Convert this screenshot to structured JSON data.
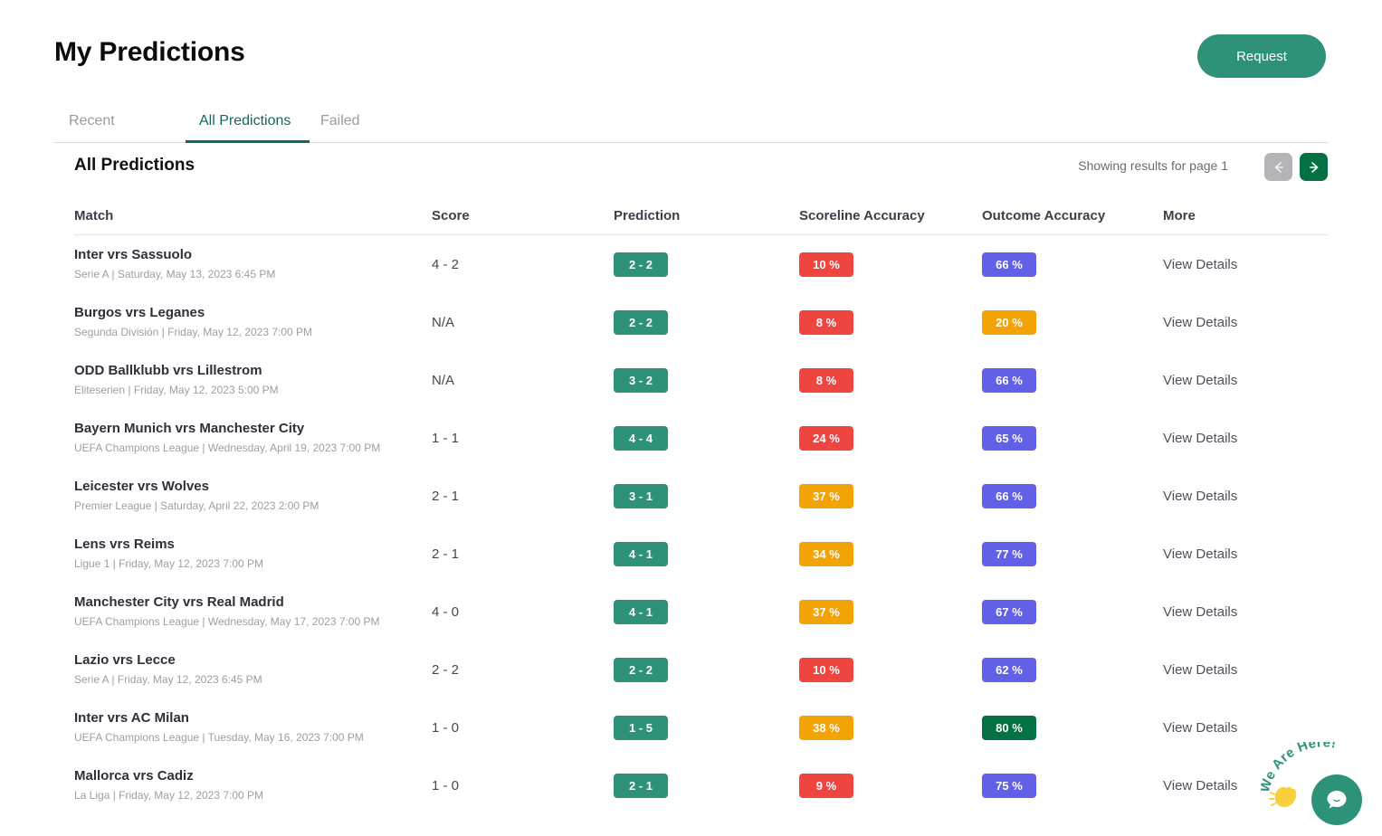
{
  "header": {
    "title": "My Predictions",
    "request_label": "Request"
  },
  "tabs": [
    {
      "label": "Recent",
      "active": false
    },
    {
      "label": "All Predictions",
      "active": true
    },
    {
      "label": "Failed",
      "active": false
    }
  ],
  "section": {
    "title": "All Predictions",
    "results_label": "Showing results for page 1",
    "prev_icon": "arrow-left-icon",
    "next_icon": "arrow-right-icon"
  },
  "table": {
    "columns": [
      "Match",
      "Score",
      "Prediction",
      "Scoreline Accuracy",
      "Outcome Accuracy",
      "More"
    ],
    "more_label": "View Details",
    "rows": [
      {
        "match": "Inter vrs Sassuolo",
        "meta": "Serie A | Saturday, May 13, 2023 6:45 PM",
        "score": "4 - 2",
        "prediction": "2 - 2",
        "scoreline_accuracy": "10 %",
        "outcome_accuracy": "66 %",
        "more": "View Details"
      },
      {
        "match": "Burgos vrs Leganes",
        "meta": "Segunda División | Friday, May 12, 2023 7:00 PM",
        "score": "N/A",
        "prediction": "2 - 2",
        "scoreline_accuracy": "8 %",
        "outcome_accuracy": "20 %",
        "more": "View Details"
      },
      {
        "match": "ODD Ballklubb vrs Lillestrom",
        "meta": "Eliteserien | Friday, May 12, 2023 5:00 PM",
        "score": "N/A",
        "prediction": "3 - 2",
        "scoreline_accuracy": "8 %",
        "outcome_accuracy": "66 %",
        "more": "View Details"
      },
      {
        "match": "Bayern Munich vrs Manchester City",
        "meta": "UEFA Champions League | Wednesday, April 19, 2023 7:00 PM",
        "score": "1 - 1",
        "prediction": "4 - 4",
        "scoreline_accuracy": "24 %",
        "outcome_accuracy": "65 %",
        "more": "View Details"
      },
      {
        "match": "Leicester vrs Wolves",
        "meta": "Premier League | Saturday, April 22, 2023 2:00 PM",
        "score": "2 - 1",
        "prediction": "3 - 1",
        "scoreline_accuracy": "37 %",
        "outcome_accuracy": "66 %",
        "more": "View Details"
      },
      {
        "match": "Lens vrs Reims",
        "meta": "Ligue 1 | Friday, May 12, 2023 7:00 PM",
        "score": "2 - 1",
        "prediction": "4 - 1",
        "scoreline_accuracy": "34 %",
        "outcome_accuracy": "77 %",
        "more": "View Details"
      },
      {
        "match": "Manchester City vrs Real Madrid",
        "meta": "UEFA Champions League | Wednesday, May 17, 2023 7:00 PM",
        "score": "4 - 0",
        "prediction": "4 - 1",
        "scoreline_accuracy": "37 %",
        "outcome_accuracy": "67 %",
        "more": "View Details"
      },
      {
        "match": "Lazio vrs Lecce",
        "meta": "Serie A | Friday, May 12, 2023 6:45 PM",
        "score": "2 - 2",
        "prediction": "2 - 2",
        "scoreline_accuracy": "10 %",
        "outcome_accuracy": "62 %",
        "more": "View Details"
      },
      {
        "match": "Inter vrs AC Milan",
        "meta": "UEFA Champions League | Tuesday, May 16, 2023 7:00 PM",
        "score": "1 - 0",
        "prediction": "1 - 5",
        "scoreline_accuracy": "38 %",
        "outcome_accuracy": "80 %",
        "more": "View Details"
      },
      {
        "match": "Mallorca vrs Cadiz",
        "meta": "La Liga | Friday, May 12, 2023 7:00 PM",
        "score": "1 - 0",
        "prediction": "2 - 1",
        "scoreline_accuracy": "9 %",
        "outcome_accuracy": "75 %",
        "more": "View Details"
      }
    ]
  },
  "chat_widget": {
    "text": "We Are Here!",
    "hand_icon": "waving-hand-icon",
    "bubble_icon": "chat-bubble-icon"
  },
  "colors": {
    "brand_teal": "#2e9278",
    "tab_active": "#12695b",
    "badge_prediction": "#2e9278",
    "badge_low": "#ee4540",
    "badge_mid": "#f4a307",
    "badge_outcome": "#6360e8",
    "badge_high": "#057044",
    "pager_next": "#057044",
    "pager_prev": "#b3b3b8"
  }
}
